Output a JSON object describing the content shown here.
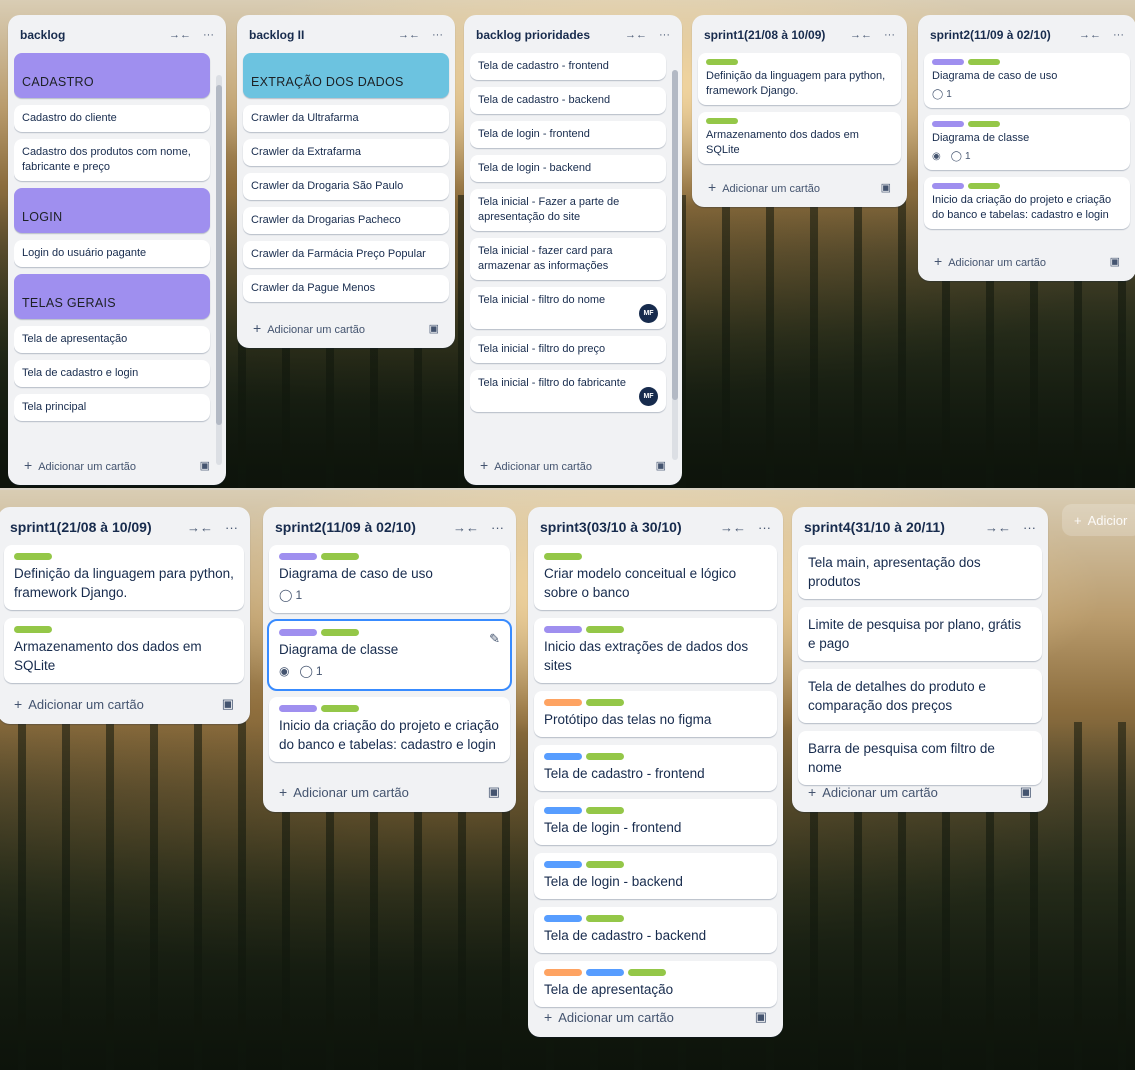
{
  "common": {
    "add_card": "Adicionar um cartão",
    "more": "···",
    "collapse": "→←",
    "plus": "+",
    "template_icon": "▣",
    "eye": "◉",
    "comment": "◯"
  },
  "top": {
    "lists": [
      {
        "title": "backlog",
        "cards": [
          {
            "type": "label",
            "text": "CADASTRO"
          },
          {
            "text": "Cadastro do cliente"
          },
          {
            "text": "Cadastro dos produtos com nome, fabricante e preço"
          },
          {
            "type": "label",
            "text": "LOGIN"
          },
          {
            "text": "Login do usuário pagante"
          },
          {
            "type": "label",
            "text": "TELAS GERAIS"
          },
          {
            "text": "Tela de apresentação"
          },
          {
            "text": "Tela de cadastro e login"
          },
          {
            "text": "Tela principal"
          }
        ]
      },
      {
        "title": "backlog II",
        "cards": [
          {
            "type": "label",
            "text": "EXTRAÇÃO DOS DADOS"
          },
          {
            "text": "Crawler da Ultrafarma"
          },
          {
            "text": "Crawler da Extrafarma"
          },
          {
            "text": "Crawler da Drogaria São Paulo"
          },
          {
            "text": "Crawler da Drogarias Pacheco"
          },
          {
            "text": "Crawler da Farmácia Preço Popular"
          },
          {
            "text": "Crawler da Pague Menos"
          }
        ]
      },
      {
        "title": "backlog prioridades",
        "cards": [
          {
            "text": "Tela de cadastro - frontend"
          },
          {
            "text": "Tela de cadastro - backend"
          },
          {
            "text": "Tela de login - frontend"
          },
          {
            "text": "Tela de login - backend"
          },
          {
            "text": "Tela inicial - Fazer a parte de apresentação do site"
          },
          {
            "text": "Tela inicial - fazer card para armazenar as informações"
          },
          {
            "text": "Tela inicial - filtro do nome",
            "avatar": "MF"
          },
          {
            "text": "Tela inicial - filtro do preço"
          },
          {
            "text": "Tela inicial - filtro do fabricante",
            "avatar": "MF"
          }
        ]
      },
      {
        "title": "sprint1(21/08 à 10/09)",
        "cards": [
          {
            "text": "Definição da linguagem para python, framework Django.",
            "labels": [
              "green"
            ]
          },
          {
            "text": "Armazenamento dos dados em SQLite",
            "labels": [
              "green"
            ]
          }
        ]
      },
      {
        "title": "sprint2(11/09 à 02/10)",
        "cards": [
          {
            "text": "Diagrama de caso de uso",
            "labels": [
              "purple",
              "green"
            ],
            "comments": "1"
          },
          {
            "text": "Diagrama de classe",
            "labels": [
              "purple",
              "green"
            ],
            "eye": true,
            "comments": "1"
          },
          {
            "text": "Inicio da criação do projeto e criação do banco e tabelas: cadastro e login",
            "labels": [
              "purple",
              "green"
            ]
          }
        ]
      }
    ]
  },
  "bottom": {
    "ghost_add": "Adicior",
    "lists": [
      {
        "title": "sprint1(21/08 à 10/09)",
        "cards": [
          {
            "text": "Definição da linguagem para python, framework Django.",
            "labels": [
              "green"
            ]
          },
          {
            "text": "Armazenamento dos dados em SQLite",
            "labels": [
              "green"
            ]
          }
        ]
      },
      {
        "title": "sprint2(11/09 à 02/10)",
        "cards": [
          {
            "text": "Diagrama de caso de uso",
            "labels": [
              "purple",
              "green"
            ],
            "comments": "1"
          },
          {
            "text": "Diagrama de classe",
            "labels": [
              "purple",
              "green"
            ],
            "eye": true,
            "comments": "1",
            "selected": true
          },
          {
            "text": "Inicio da criação do projeto e criação do banco e tabelas: cadastro e login",
            "labels": [
              "purple",
              "green"
            ]
          }
        ]
      },
      {
        "title": "sprint3(03/10 à 30/10)",
        "cards": [
          {
            "text": "Criar modelo conceitual e lógico sobre o banco",
            "labels": [
              "green"
            ]
          },
          {
            "text": "Inicio das extrações de dados dos sites",
            "labels": [
              "purple",
              "green"
            ]
          },
          {
            "text": "Protótipo das telas no figma",
            "labels": [
              "orange",
              "green"
            ]
          },
          {
            "text": "Tela de cadastro - frontend",
            "labels": [
              "blue",
              "green"
            ]
          },
          {
            "text": "Tela de login - frontend",
            "labels": [
              "blue",
              "green"
            ]
          },
          {
            "text": "Tela de login - backend",
            "labels": [
              "blue",
              "green"
            ]
          },
          {
            "text": "Tela de cadastro - backend",
            "labels": [
              "blue",
              "green"
            ]
          },
          {
            "text": "Tela de apresentação",
            "labels": [
              "orange",
              "blue",
              "green"
            ]
          }
        ]
      },
      {
        "title": "sprint4(31/10 à 20/11)",
        "cards": [
          {
            "text": "Tela main, apresentação dos produtos"
          },
          {
            "text": "Limite de pesquisa por plano, grátis e pago"
          },
          {
            "text": "Tela de detalhes do produto e comparação dos preços"
          },
          {
            "text": "Barra de pesquisa com filtro de nome"
          }
        ]
      }
    ]
  }
}
